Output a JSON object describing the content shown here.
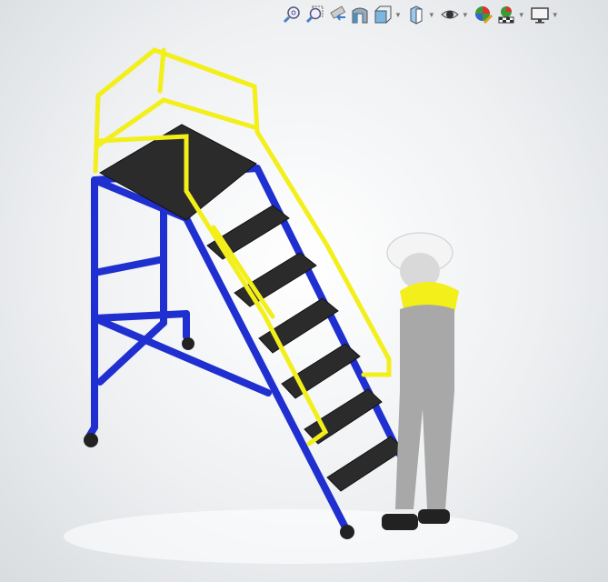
{
  "toolbar": {
    "items": [
      {
        "icon": "zoom-to-fit-icon",
        "dropdown": false
      },
      {
        "icon": "zoom-to-area-icon",
        "dropdown": false
      },
      {
        "icon": "previous-view-icon",
        "dropdown": false
      },
      {
        "icon": "section-view-icon",
        "dropdown": false
      },
      {
        "icon": "view-orientation-icon",
        "dropdown": true
      },
      {
        "icon": "display-style-icon",
        "dropdown": true
      },
      {
        "icon": "hide-show-items-icon",
        "dropdown": true
      },
      {
        "icon": "edit-appearance-icon",
        "dropdown": false
      },
      {
        "icon": "apply-scene-icon",
        "dropdown": true
      },
      {
        "icon": "view-settings-icon",
        "dropdown": true
      }
    ]
  },
  "colors": {
    "frame": "#1f2fd0",
    "rail": "#f2ef1a",
    "tread": "#2b2b2b",
    "background": "#eef0f2"
  }
}
